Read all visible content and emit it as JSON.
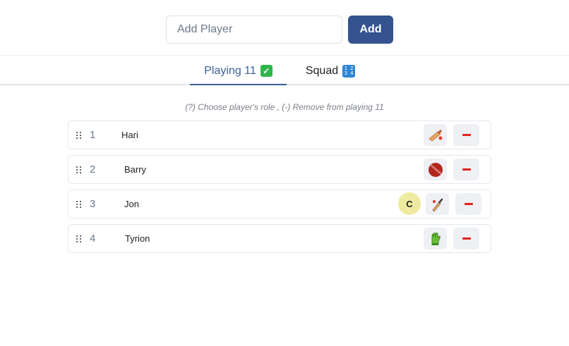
{
  "add_player": {
    "placeholder": "Add Player",
    "button_label": "Add"
  },
  "tabs": [
    {
      "label": "Playing 11",
      "emoji": "check-mark-button-emoji",
      "active": true
    },
    {
      "label": "Squad",
      "emoji": "input-numbers-emoji",
      "active": false
    }
  ],
  "hint": "(?) Choose player's role , (-) Remove from playing 11",
  "players": [
    {
      "index": "1",
      "name": "Hari",
      "role_icon": "cricket-bat-icon",
      "captain": ""
    },
    {
      "index": "2",
      "name": "Barry",
      "role_icon": "cricket-ball-icon",
      "captain": ""
    },
    {
      "index": "3",
      "name": "Jon",
      "role_icon": "cricket-bat-ball-icon",
      "captain": "C"
    },
    {
      "index": "4",
      "name": "Tyrion",
      "role_icon": "keeper-glove-icon",
      "captain": ""
    }
  ],
  "colors": {
    "accent": "#34538f",
    "tab_active": "#3a5f96",
    "remove": "#e0231b",
    "captain_bg": "#eeeaa0"
  }
}
